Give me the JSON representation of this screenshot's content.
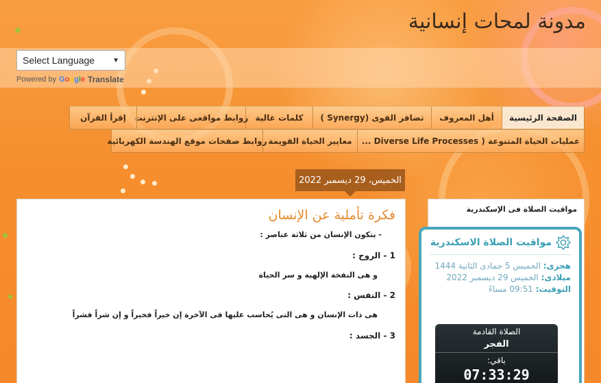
{
  "site": {
    "title": "مدونة لمحات إنسانية"
  },
  "translate": {
    "select_label": "Select Language",
    "powered_by": "Powered by",
    "google": [
      "G",
      "o",
      "o",
      "g",
      "l",
      "e"
    ],
    "google_colors": [
      "#4285f4",
      "#ea4335",
      "#fbbc05",
      "#4285f4",
      "#34a853",
      "#ea4335"
    ],
    "translate_label": "Translate"
  },
  "nav": {
    "row1": [
      "الصفحة الرئيسية",
      "أهل المعروف",
      "تضافر القوى (Synergy )",
      "كلمات غالية",
      "روابط مواقعى على الإنترنت",
      "إقرأ القرآن"
    ],
    "row2": [
      "عمليات الحياة المتنوعة ( Diverse Life Processes ...",
      "معايير الحياة القويمة",
      "روابط صفحات موقع الهندسة الكهربائية"
    ]
  },
  "post": {
    "date": "الخميس، 29 ديسمبر 2022",
    "title": "فكرة تأملية عن الإنسان",
    "lines": [
      "-   يتكون الإنسان من ثلاثة عناصر :",
      "1 -  الروح :",
      "و هى النفخة الإلهية و سر الحياة",
      "2 -  النفس  :",
      "هى ذات الإنسان و هى التى يُحاسب عليها فى الآخرة إن خيراً فخيراً و إن شراً فشراً",
      "3 -  الجسد  :"
    ]
  },
  "sidebar": {
    "title": "مواقيت الصلاة فى الإسكندرية",
    "widget": {
      "heading": "مواقيت الصلاة الاسكندرية",
      "hijri_label": "هجرى:",
      "hijri_value": "الخميس 5 جمادى الثانية 1444",
      "miladi_label": "ميلادى:",
      "miladi_value": "الخميس 29 ديسمبر 2022",
      "time_label": "التوقيت:",
      "time_value": "09:51 مساءً",
      "next_label": "الصلاة القادمة",
      "next_prayer": "الفجر",
      "remaining_label": "باقي:",
      "remaining_value": "07:33:29"
    }
  },
  "colors": {
    "background": "#f5922f",
    "accent": "#e58a2e",
    "badge": "#a85e1c",
    "widget": "#46a6ba"
  }
}
